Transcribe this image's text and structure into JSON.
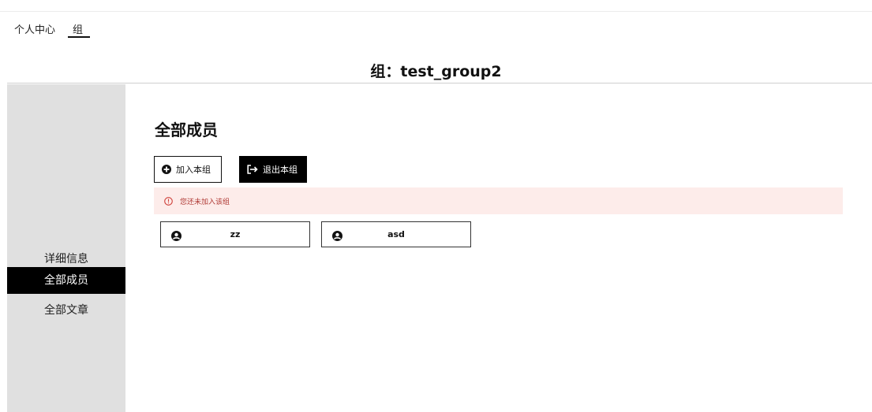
{
  "nav": {
    "items": [
      {
        "label": "个人中心"
      },
      {
        "label": "组"
      }
    ],
    "active": "组"
  },
  "header": {
    "title": "组：test_group2"
  },
  "sidebar": {
    "items": [
      {
        "label": "详细信息"
      },
      {
        "label": "全部成员"
      },
      {
        "label": "全部文章"
      }
    ],
    "active": "全部成员"
  },
  "main": {
    "section_title": "全部成员",
    "buttons": {
      "join": {
        "label": "加入本组",
        "icon": "plus-circle-icon"
      },
      "leave": {
        "label": "退出本组",
        "icon": "sign-out-icon"
      }
    },
    "alert": {
      "text": "您还未加入该组",
      "icon": "alert-circle-icon",
      "color": "#b03a35",
      "background": "#fdecea"
    },
    "members": [
      {
        "name": "zz",
        "icon": "user-circle-icon"
      },
      {
        "name": "asd",
        "icon": "user-circle-icon"
      }
    ]
  },
  "colors": {
    "sidebar_bg": "#e0e0e0",
    "active_bg": "#000000",
    "active_text": "#ffffff"
  }
}
